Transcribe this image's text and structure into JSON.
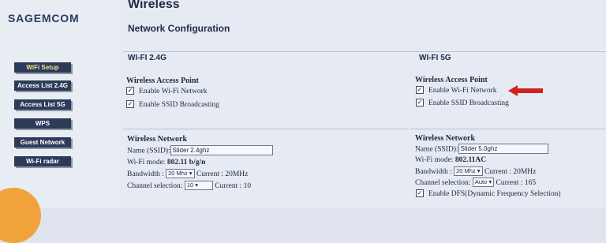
{
  "brand": "SAGEMCOM",
  "sidebar": {
    "items": [
      {
        "label": "WiFi Setup"
      },
      {
        "label": "Access List 2.4G"
      },
      {
        "label": "Access List 5G"
      },
      {
        "label": "WPS"
      },
      {
        "label": "Guest Network"
      },
      {
        "label": "Wi-Fi radar"
      }
    ]
  },
  "header": {
    "title": "Wireless",
    "subtitle": "Network Configuration"
  },
  "band24": {
    "title": "WI-FI 2.4G",
    "ap_heading": "Wireless Access Point",
    "enable_wifi": "Enable Wi-Fi Network",
    "enable_ssid": "Enable SSID Broadcasting",
    "net_heading": "Wireless Network",
    "ssid_label": "Name (SSID):",
    "ssid_value": "Slider 2.4ghz",
    "mode_label": "Wi-Fi mode:",
    "mode_value": "802.11 b/g/n",
    "bandwidth_label": "Bandwidth :",
    "bandwidth_value": "20 Mhz",
    "current_bw_label": "Current :",
    "current_bw_value": "20MHz",
    "channel_label": "Channel selection:",
    "channel_value": "10",
    "current_ch_label": "Current :",
    "current_ch_value": "10"
  },
  "band5": {
    "title": "WI-FI 5G",
    "ap_heading": "Wireless Access Point",
    "enable_wifi": "Enable Wi-Fi Network",
    "enable_ssid": "Enable SSID Broadcasting",
    "net_heading": "Wireless Network",
    "ssid_label": "Name (SSID):",
    "ssid_value": "Slider 5.0ghz",
    "mode_label": "Wi-Fi mode:",
    "mode_value": "802.11AC",
    "bandwidth_label": "Bandwidth :",
    "bandwidth_value": "20 Mhz",
    "current_bw_label": "Current :",
    "current_bw_value": "20MHz",
    "channel_label": "Channel selection:",
    "channel_value": "Auto",
    "current_ch_label": "Current :",
    "current_ch_value": "165",
    "dfs_label": "Enable DFS(Dynamic Frequency Selection)"
  },
  "colors": {
    "nav_button": "#2d3a58",
    "active_text": "#f2e38a",
    "annotation_arrow": "#d0231c",
    "orb": "#f2a23a"
  },
  "icons": {
    "annotation": "red-arrow-icon",
    "checkbox": "checkmark-icon",
    "dropdown": "triangle-down-icon"
  }
}
